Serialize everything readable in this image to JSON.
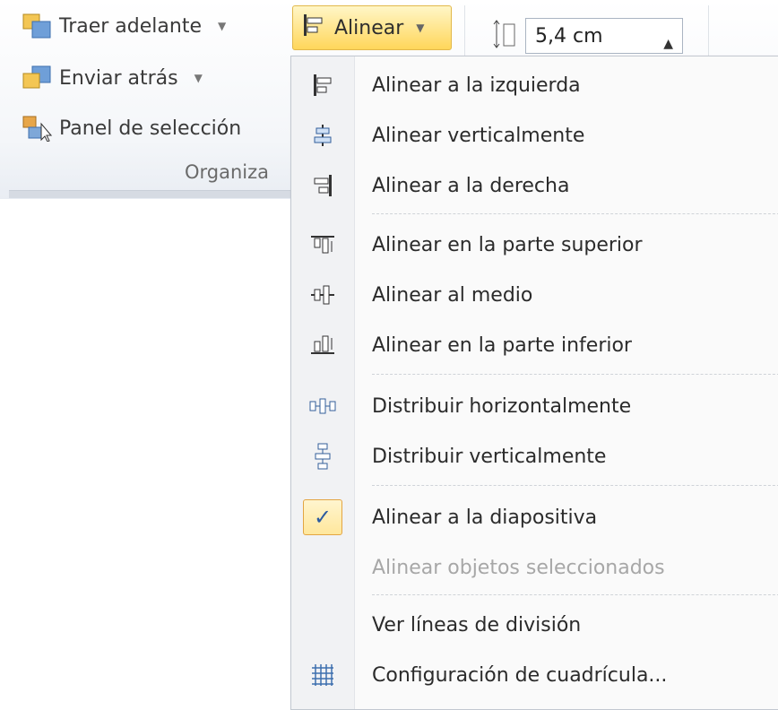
{
  "ribbon": {
    "traer_adelante": "Traer adelante",
    "enviar_atras": "Enviar atrás",
    "panel_seleccion": "Panel de selección",
    "group_label": "Organiza",
    "alinear_label": "Alinear",
    "size_value": "5,4 cm"
  },
  "menu": {
    "items": [
      {
        "label": "Alinear a la izquierda",
        "icon": "align-left-icon"
      },
      {
        "label": "Alinear verticalmente",
        "icon": "align-center-icon"
      },
      {
        "label": "Alinear a la derecha",
        "icon": "align-right-icon"
      },
      {
        "label": "Alinear en la parte superior",
        "icon": "align-top-icon"
      },
      {
        "label": "Alinear al medio",
        "icon": "align-middle-icon"
      },
      {
        "label": "Alinear en la parte inferior",
        "icon": "align-bottom-icon"
      },
      {
        "label": "Distribuir horizontalmente",
        "icon": "distribute-horizontal-icon"
      },
      {
        "label": "Distribuir verticalmente",
        "icon": "distribute-vertical-icon"
      },
      {
        "label": "Alinear a la diapositiva",
        "icon": "check-icon",
        "checked": true
      },
      {
        "label": "Alinear objetos seleccionados",
        "icon": "",
        "disabled": true
      },
      {
        "label": "Ver líneas de división",
        "icon": ""
      },
      {
        "label": "Configuración de cuadrícula...",
        "icon": "grid-icon"
      }
    ]
  },
  "colors": {
    "accent_button": "#ffd65a",
    "checked_color": "#2c5aa0",
    "disabled_text": "#a7a7a7"
  }
}
